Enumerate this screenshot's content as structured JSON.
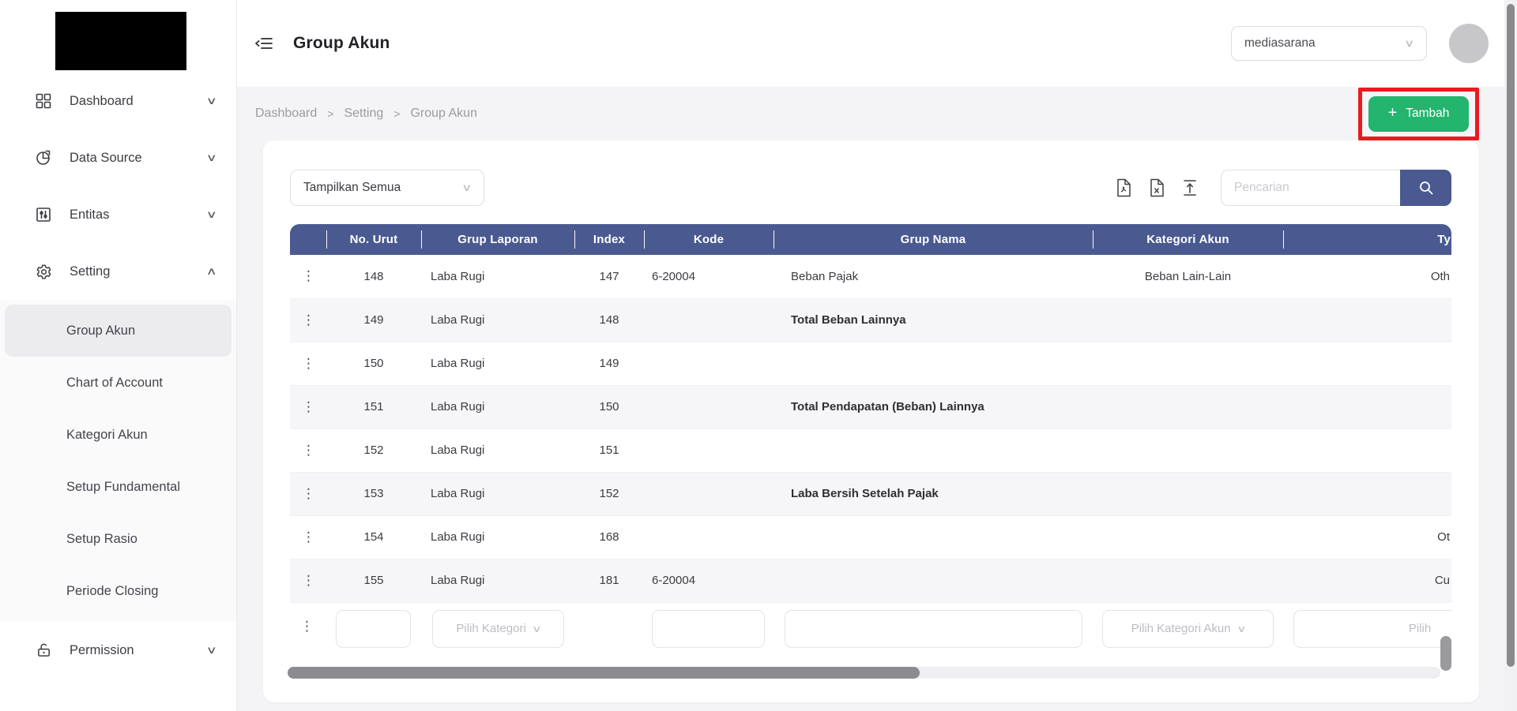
{
  "icons": {
    "chevron_down": "∨",
    "chevron_up": "∧",
    "kebab": "⋮",
    "plus": "+"
  },
  "sidebar": {
    "menu": [
      {
        "label": "Dashboard"
      },
      {
        "label": "Data Source"
      },
      {
        "label": "Entitas"
      },
      {
        "label": "Setting"
      }
    ],
    "submenu": [
      "Group Akun",
      "Chart of Account",
      "Kategori Akun",
      "Setup Fundamental",
      "Setup Rasio",
      "Periode Closing"
    ],
    "active_submenu": "Group Akun",
    "bottom_menu": [
      {
        "label": "Permission"
      }
    ]
  },
  "topbar": {
    "title": "Group Akun",
    "tenant_selected": "mediasarana"
  },
  "breadcrumb": {
    "items": [
      "Dashboard",
      "Setting",
      "Group Akun"
    ],
    "separator": ">"
  },
  "page_actions": {
    "add_label": "Tambah"
  },
  "toolbar": {
    "show_filter": "Tampilkan Semua",
    "search_placeholder": "Pencarian"
  },
  "table": {
    "columns": {
      "no": "No. Urut",
      "laporan": "Grup Laporan",
      "index": "Index",
      "kode": "Kode",
      "nama": "Grup Nama",
      "kategori": "Kategori Akun",
      "type": "Ty"
    },
    "rows": [
      {
        "no": "148",
        "laporan": "Laba Rugi",
        "index": "147",
        "kode": "6-20004",
        "nama": "Beban Pajak",
        "kategori": "Beban Lain-Lain",
        "type": "Oth"
      },
      {
        "no": "149",
        "laporan": "Laba Rugi",
        "index": "148",
        "kode": "",
        "nama": "Total Beban Lainnya",
        "kategori": "",
        "type": ""
      },
      {
        "no": "150",
        "laporan": "Laba Rugi",
        "index": "149",
        "kode": "",
        "nama": "",
        "kategori": "",
        "type": ""
      },
      {
        "no": "151",
        "laporan": "Laba Rugi",
        "index": "150",
        "kode": "",
        "nama": "Total Pendapatan (Beban) Lainnya",
        "kategori": "",
        "type": ""
      },
      {
        "no": "152",
        "laporan": "Laba Rugi",
        "index": "151",
        "kode": "",
        "nama": "",
        "kategori": "",
        "type": ""
      },
      {
        "no": "153",
        "laporan": "Laba Rugi",
        "index": "152",
        "kode": "",
        "nama": "Laba Bersih Setelah Pajak",
        "kategori": "",
        "type": ""
      },
      {
        "no": "154",
        "laporan": "Laba Rugi",
        "index": "168",
        "kode": "",
        "nama": "",
        "kategori": "",
        "type": "Ot"
      },
      {
        "no": "155",
        "laporan": "Laba Rugi",
        "index": "181",
        "kode": "6-20004",
        "nama": "",
        "kategori": "",
        "type": "Cu"
      }
    ],
    "filter_row": {
      "pilih_kategori": "Pilih Kategori",
      "pilih_kategori_akun": "Pilih Kategori Akun",
      "pilih_type": "Pilih"
    }
  },
  "colors": {
    "accent_blue": "#4a5a90",
    "accent_green": "#23b46d",
    "annotation_red": "#ea1a20"
  }
}
